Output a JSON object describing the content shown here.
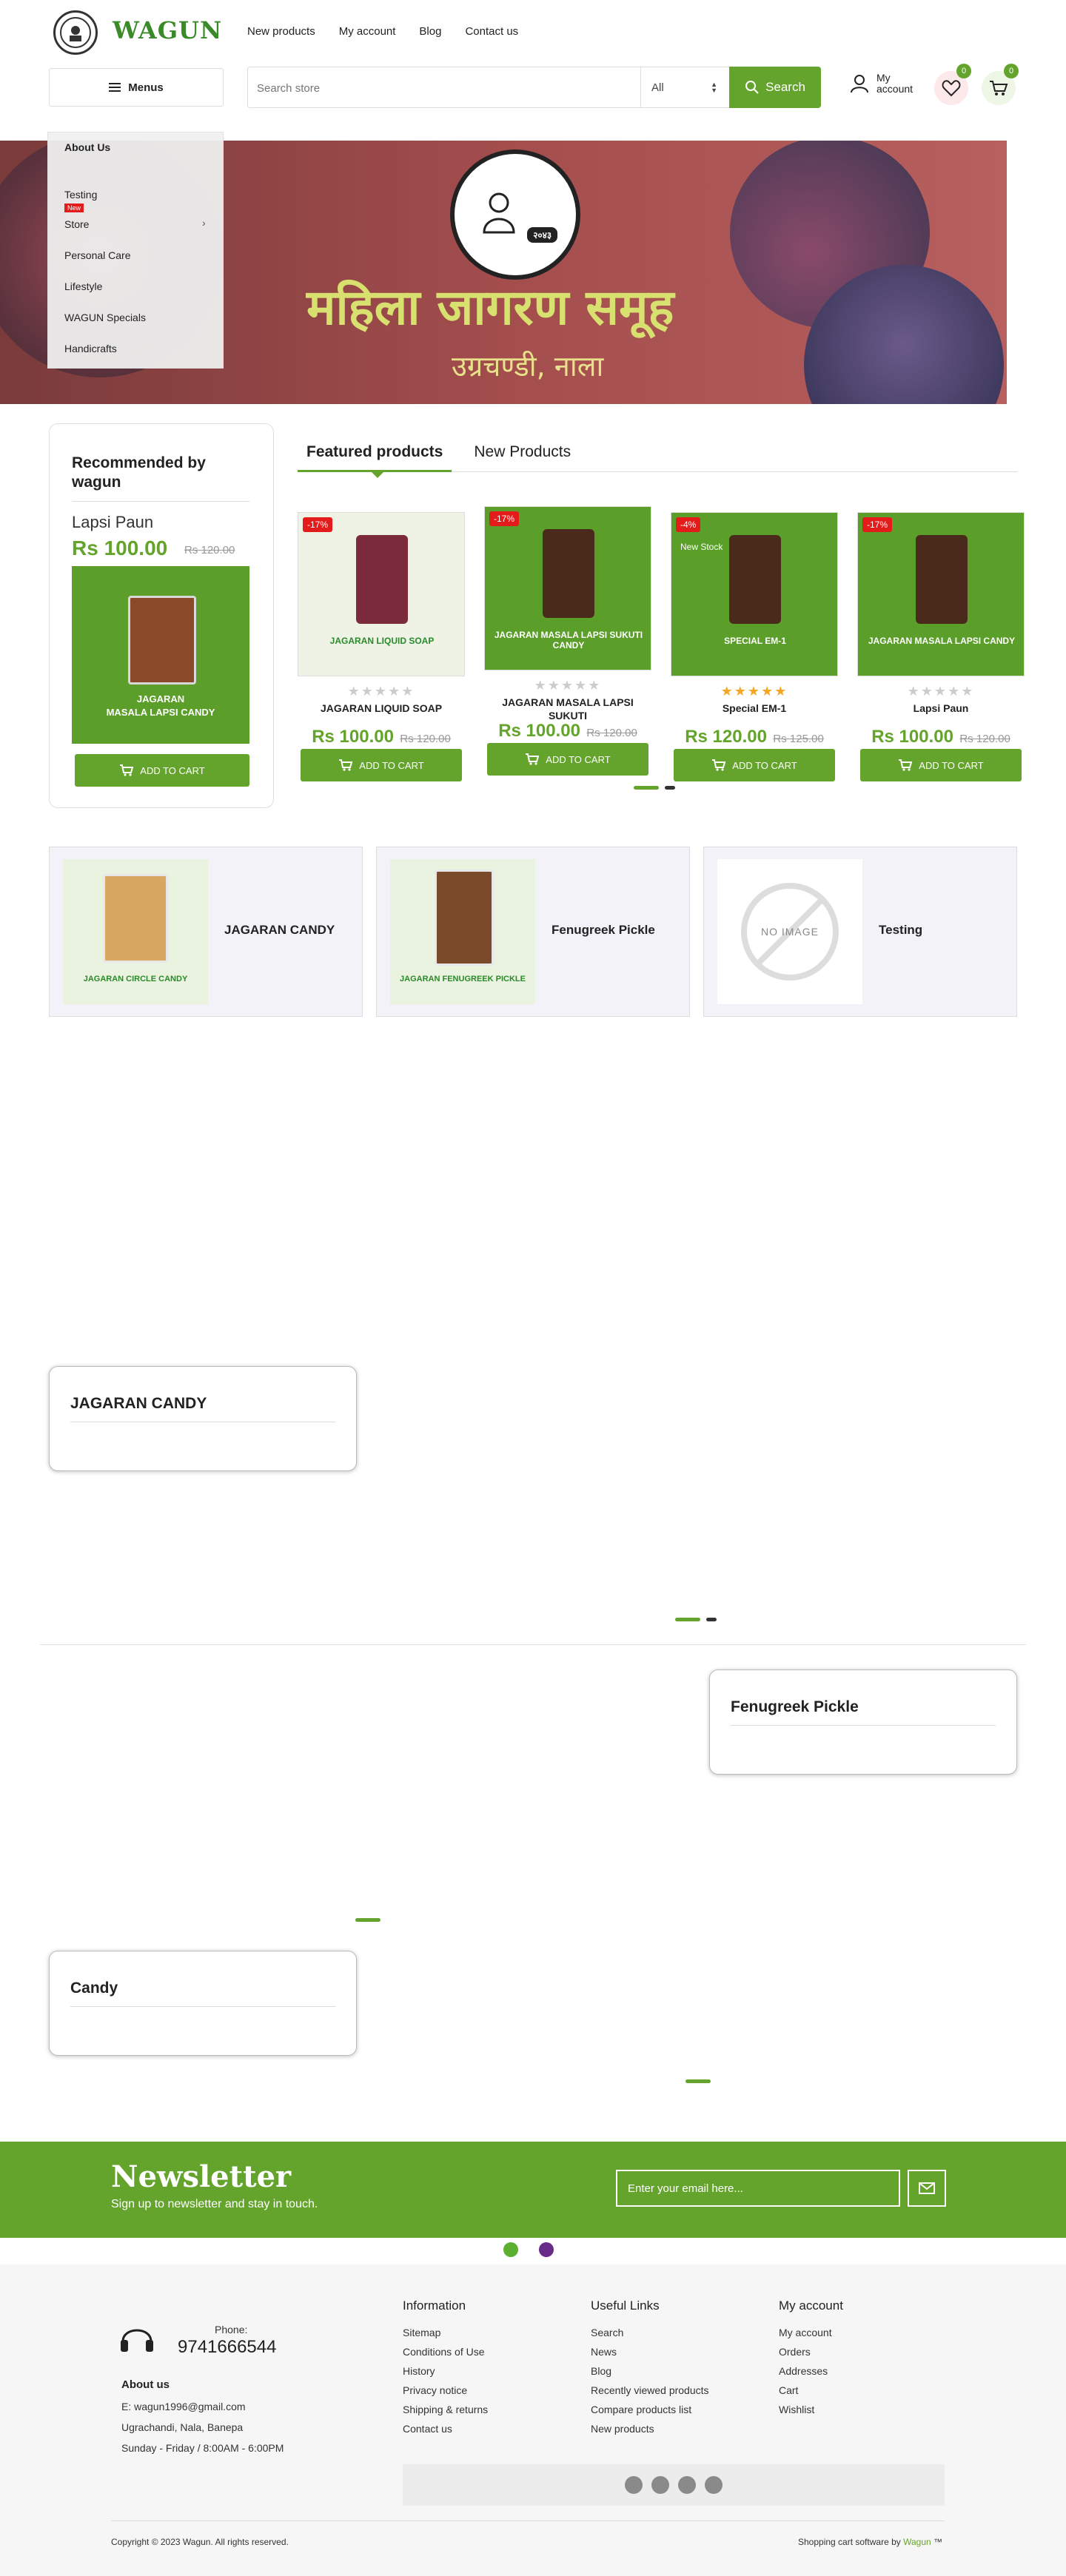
{
  "header": {
    "logo_text": "WAGUN",
    "nav": [
      "New products",
      "My account",
      "Blog",
      "Contact us"
    ],
    "menus_label": "Menus",
    "search_placeholder": "Search store",
    "search_category": "All",
    "search_button": "Search",
    "account_label_line1": "My",
    "account_label_line2": "account",
    "wishlist_count": "0",
    "cart_count": "0"
  },
  "menu": {
    "items": [
      "About Us",
      "Testing",
      "Store",
      "Personal Care",
      "Lifestyle",
      "WAGUN Specials",
      "Handicrafts"
    ],
    "new_badge": "New"
  },
  "banner": {
    "title": "महिला जागरण समूह",
    "subtitle": "उग्रचण्डी, नाला",
    "seal_year": "२०४३"
  },
  "recommended": {
    "title": "Recommended by wagun",
    "product_name": "Lapsi Paun",
    "price": "Rs 100.00",
    "old_price": "Rs 120.00",
    "image_label_line1": "JAGARAN",
    "image_label_line2": "MASALA LAPSI CANDY",
    "cart_label": "ADD TO CART"
  },
  "tabs": [
    "Featured products",
    "New Products"
  ],
  "products": [
    {
      "discount": "-17%",
      "image_label": "JAGARAN LIQUID SOAP",
      "name": "JAGARAN LIQUID SOAP",
      "price": "Rs 100.00",
      "old_price": "Rs 120.00",
      "stars": "★★★★★",
      "rated": false,
      "cart": "ADD TO CART",
      "img_color": "#eef3e6",
      "label_color": "#2a8a2a"
    },
    {
      "discount": "-17%",
      "image_label": "JAGARAN MASALA LAPSI SUKUTI CANDY",
      "name": "JAGARAN MASALA LAPSI SUKUTI",
      "price": "Rs 100.00",
      "old_price": "Rs 120.00",
      "stars": "★★★★★",
      "rated": false,
      "cart": "ADD TO CART",
      "img_color": "#5b9e2a",
      "label_color": "#ffffff"
    },
    {
      "discount": "-4%",
      "badge": "New Stock",
      "image_label": "SPECIAL EM-1",
      "name": "Special EM-1",
      "price": "Rs 120.00",
      "old_price": "Rs 125.00",
      "stars": "★★★★★",
      "rated": true,
      "cart": "ADD TO CART",
      "img_color": "#5b9e2a",
      "label_color": "#ffffff"
    },
    {
      "discount": "-17%",
      "image_label": "JAGARAN MASALA LAPSI CANDY",
      "name": "Lapsi Paun",
      "price": "Rs 100.00",
      "old_price": "Rs 120.00",
      "stars": "★★★★★",
      "rated": false,
      "cart": "ADD TO CART",
      "img_color": "#5b9e2a",
      "label_color": "#ffffff"
    }
  ],
  "categories": [
    {
      "name": "JAGARAN CANDY",
      "image_label": "JAGARAN CIRCLE CANDY"
    },
    {
      "name": "Fenugreek Pickle",
      "image_label": "JAGARAN FENUGREEK PICKLE"
    },
    {
      "name": "Testing",
      "image_label": "NO IMAGE"
    }
  ],
  "category_cards": [
    "JAGARAN CANDY",
    "Fenugreek Pickle",
    "Candy"
  ],
  "newsletter": {
    "title": "Newsletter",
    "subtitle": "Sign up to newsletter and stay in touch.",
    "placeholder": "Enter your email here..."
  },
  "footer": {
    "phone_label": "Phone:",
    "phone": "9741666544",
    "about_title": "About us",
    "email": "E: wagun1996@gmail.com",
    "address": "Ugrachandi, Nala, Banepa",
    "hours": "Sunday - Friday / 8:00AM - 6:00PM",
    "information": {
      "title": "Information",
      "links": [
        "Sitemap",
        "Conditions of Use",
        "History",
        "Privacy notice",
        "Shipping & returns",
        "Contact us"
      ]
    },
    "useful": {
      "title": "Useful Links",
      "links": [
        "Search",
        "News",
        "Blog",
        "Recently viewed products",
        "Compare products list",
        "New products"
      ]
    },
    "account": {
      "title": "My account",
      "links": [
        "My account",
        "Orders",
        "Addresses",
        "Cart",
        "Wishlist"
      ]
    },
    "copyright": "Copyright © 2023 Wagun. All rights reserved.",
    "powered_prefix": "Shopping cart software by",
    "powered_link": "Wagun",
    "powered_suffix": "™"
  },
  "colors": {
    "accent": "#64a42c",
    "discount": "#e31b1b",
    "brand_text": "#3a8a2a"
  }
}
